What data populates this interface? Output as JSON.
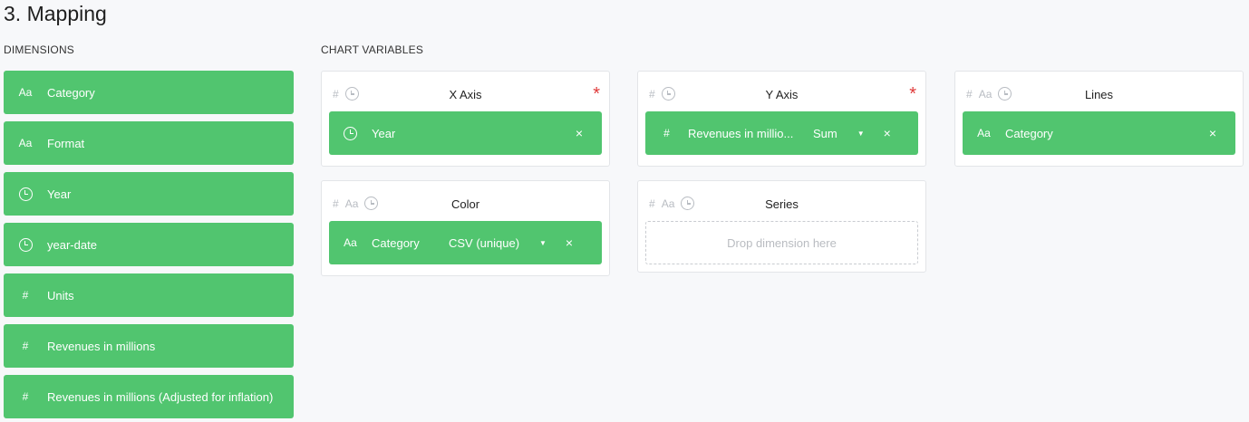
{
  "header": {
    "title": "3. Mapping"
  },
  "dimensions": {
    "label": "DIMENSIONS",
    "items": [
      {
        "type": "Aa",
        "label": "Category"
      },
      {
        "type": "Aa",
        "label": "Format"
      },
      {
        "type": "clock",
        "label": "Year"
      },
      {
        "type": "clock",
        "label": "year-date"
      },
      {
        "type": "#",
        "label": "Units"
      },
      {
        "type": "#",
        "label": "Revenues in millions"
      },
      {
        "type": "#",
        "label": "Revenues in millions (Adjusted for inflation)"
      }
    ]
  },
  "chart_variables": {
    "label": "CHART VARIABLES",
    "drop_placeholder": "Drop dimension here",
    "x_axis": {
      "title": "X Axis",
      "required": "*",
      "type_icons": [
        "#",
        "clock"
      ],
      "mapped": {
        "type": "clock",
        "label": "Year",
        "remove": "×"
      }
    },
    "y_axis": {
      "title": "Y Axis",
      "required": "*",
      "type_icons": [
        "#",
        "clock"
      ],
      "mapped": {
        "type": "#",
        "label": "Revenues in millio...",
        "aggregation": "Sum",
        "caret": "▼",
        "remove": "×"
      }
    },
    "lines": {
      "title": "Lines",
      "type_icons": [
        "#",
        "Aa",
        "clock"
      ],
      "mapped": {
        "type": "Aa",
        "label": "Category",
        "remove": "×"
      }
    },
    "color": {
      "title": "Color",
      "type_icons": [
        "#",
        "Aa",
        "clock"
      ],
      "mapped": {
        "type": "Aa",
        "label": "Category",
        "aggregation": "CSV (unique)",
        "caret": "▼",
        "remove": "×"
      }
    },
    "series": {
      "title": "Series",
      "type_icons": [
        "#",
        "Aa",
        "clock"
      ]
    }
  },
  "colors": {
    "accent_green": "#51c56f",
    "required_red": "#e03a3a"
  }
}
